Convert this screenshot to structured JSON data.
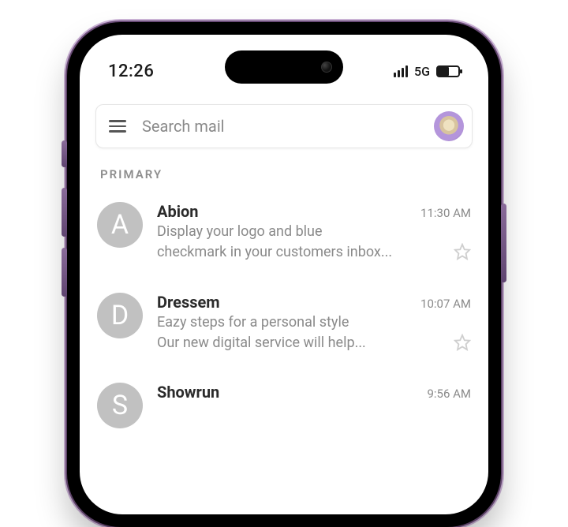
{
  "status": {
    "time": "12:26",
    "network": "5G"
  },
  "search": {
    "placeholder": "Search mail"
  },
  "section_label": "PRIMARY",
  "emails": [
    {
      "initial": "A",
      "sender": "Abion",
      "time": "11:30 AM",
      "line1": "Display your logo and blue",
      "line2": "checkmark in your customers inbox..."
    },
    {
      "initial": "D",
      "sender": "Dressem",
      "time": "10:07 AM",
      "line1": "Eazy steps for a personal style",
      "line2": "Our new digital service will help..."
    },
    {
      "initial": "S",
      "sender": "Showrun",
      "time": "9:56 AM",
      "line1": "",
      "line2": ""
    }
  ]
}
